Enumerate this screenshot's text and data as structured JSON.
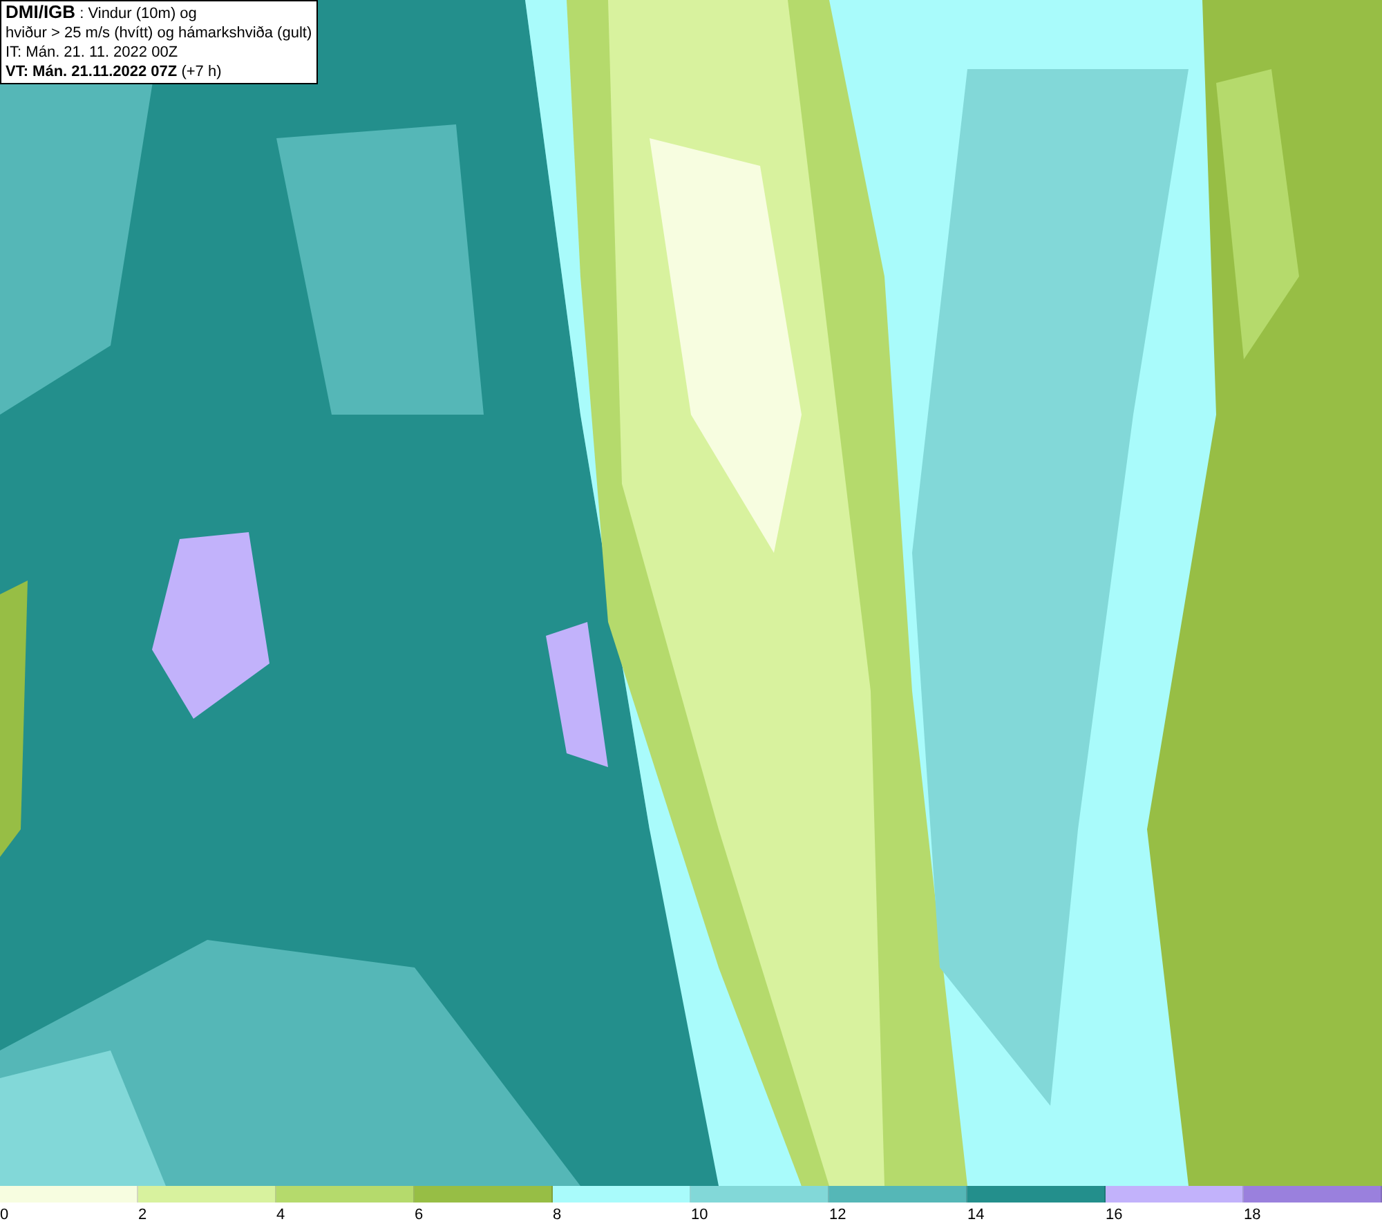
{
  "title_box": {
    "lines": [
      {
        "kind": "title",
        "source": "DMI/IGB",
        "text": " : Vindur (10m) og"
      },
      {
        "kind": "plain",
        "text": "hviður > 25 m/s (hvítt) og hámarkshviða (gult)"
      },
      {
        "kind": "plain",
        "text": "IT: Mán. 21. 11. 2022 00Z"
      },
      {
        "kind": "valid",
        "bold": "VT: Mán. 21.11.2022 07Z",
        "text": " (+7 h)"
      }
    ]
  },
  "legend": [
    {
      "label": "0",
      "color": "#f7fde0"
    },
    {
      "label": "2",
      "color": "#d8f29e"
    },
    {
      "label": "4",
      "color": "#b5da6c"
    },
    {
      "label": "6",
      "color": "#97be45"
    },
    {
      "label": "8",
      "color": "#a9fbfb"
    },
    {
      "label": "10",
      "color": "#82d8d8"
    },
    {
      "label": "12",
      "color": "#55b7b7"
    },
    {
      "label": "14",
      "color": "#238f8c"
    },
    {
      "label": "16",
      "color": "#c2b2fb"
    },
    {
      "label": "18",
      "color": "#9a80dd"
    }
  ]
}
